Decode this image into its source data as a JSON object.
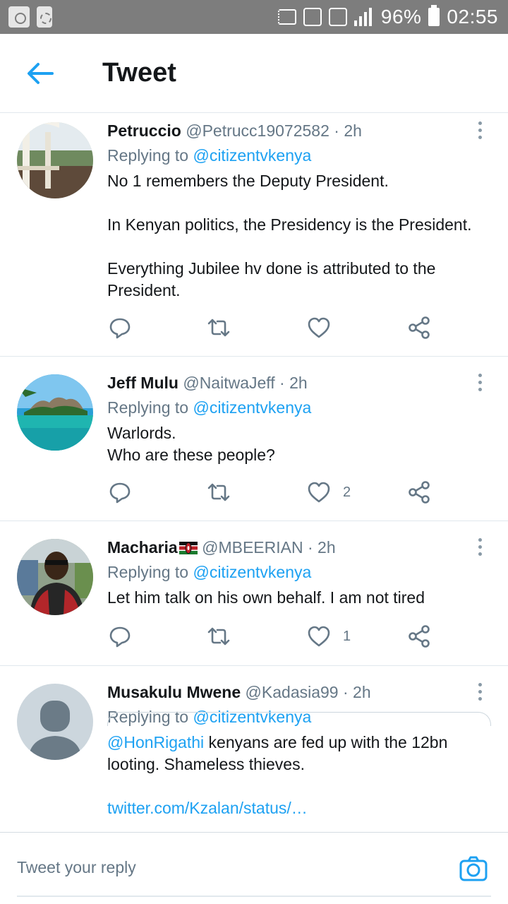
{
  "status_bar": {
    "battery": "96%",
    "time": "02:55"
  },
  "header": {
    "title": "Tweet",
    "back_icon": "arrow-left-icon"
  },
  "colors": {
    "accent": "#1da1f2",
    "secondary_text": "#657786",
    "primary_text": "#14171a",
    "divider": "#e1e8ed"
  },
  "tweets": [
    {
      "name": "Petruccio",
      "handle": "@Petrucc19072582",
      "time": "· 2h",
      "replying_prefix": "Replying to",
      "replying_to": "@citizentvkenya",
      "body": [
        "No 1 remembers the Deputy President.",
        "In Kenyan politics, the Presidency is the President.",
        "Everything Jubilee hv done is attributed to the President."
      ],
      "likes": ""
    },
    {
      "name": "Jeff Mulu",
      "handle": "@NaitwaJeff",
      "time": "· 2h",
      "replying_prefix": "Replying to",
      "replying_to": "@citizentvkenya",
      "body_line1": "Warlords.",
      "body_line2": "Who are these people?",
      "likes": "2"
    },
    {
      "name": "Macharia",
      "handle": "@MBEERIAN",
      "time": "· 2h",
      "replying_prefix": "Replying to",
      "replying_to": "@citizentvkenya",
      "body": "Let him talk on his own behalf. I am not tired",
      "likes": "1"
    },
    {
      "name": "Musakulu Mwene",
      "handle": "@Kadasia99",
      "time": "· 2h",
      "replying_prefix": "Replying to",
      "replying_to": "@citizentvkenya",
      "mention": "@HonRigathi",
      "body": " kenyans are fed up with the 12bn looting. Shameless thieves.",
      "link": "twitter.com/Kzalan/status/…"
    }
  ],
  "action_icons": [
    "reply-icon",
    "retweet-icon",
    "like-icon",
    "share-icon"
  ],
  "reply_bar": {
    "placeholder": "Tweet your reply",
    "camera_icon": "camera-icon"
  }
}
